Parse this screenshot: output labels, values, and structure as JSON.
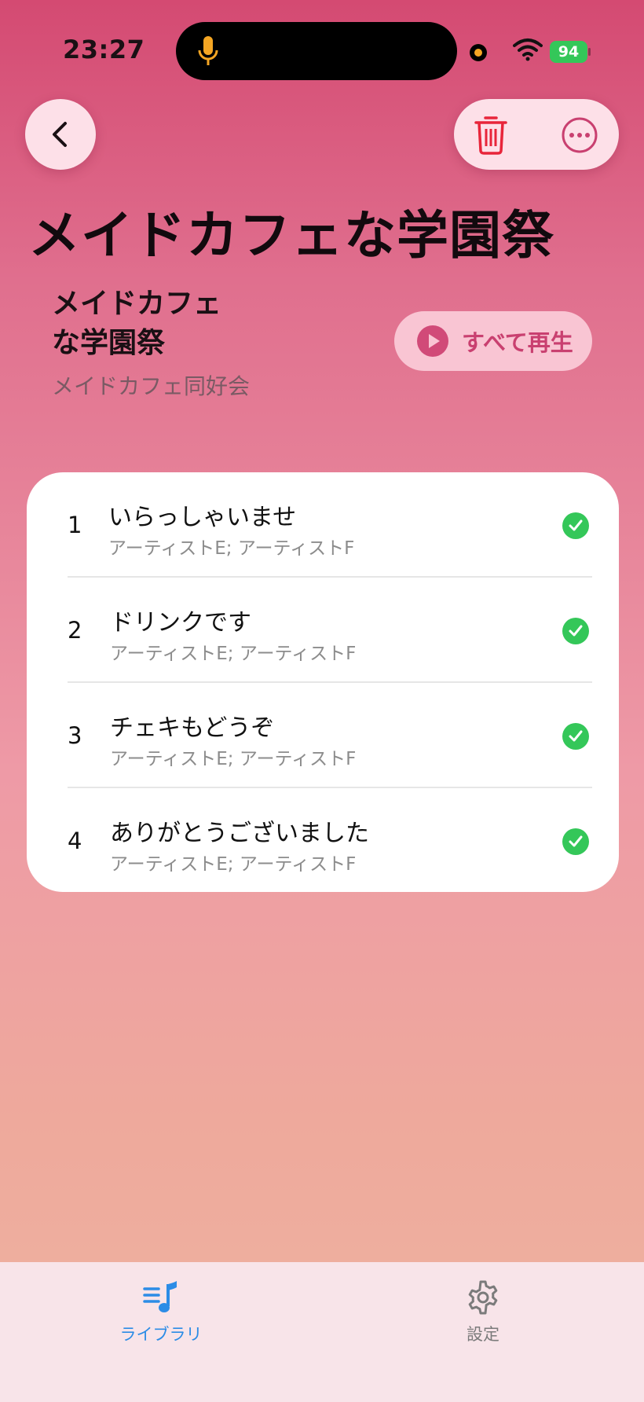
{
  "status_bar": {
    "time": "23:27",
    "battery": "94"
  },
  "header": {
    "title": "メイドカフェな学園祭"
  },
  "album": {
    "title_line1": "メイドカフェ",
    "title_line2": "な学園祭",
    "artist": "メイドカフェ同好会",
    "play_all_label": "すべて再生"
  },
  "tracks": [
    {
      "number": "1",
      "title": "いらっしゃいませ",
      "artists": "アーティストE; アーティストF"
    },
    {
      "number": "2",
      "title": "ドリンクです",
      "artists": "アーティストE; アーティストF"
    },
    {
      "number": "3",
      "title": "チェキもどうぞ",
      "artists": "アーティストE; アーティストF"
    },
    {
      "number": "4",
      "title": "ありがとうございました",
      "artists": "アーティストE; アーティストF"
    }
  ],
  "tab_bar": {
    "library_label": "ライブラリ",
    "settings_label": "設定"
  },
  "icons": {
    "back": "chevron-left-icon",
    "trash": "trash-icon",
    "more": "ellipsis-circle-icon",
    "play": "play-circle-icon",
    "check": "checkmark-circle-icon",
    "library": "music-list-icon",
    "settings": "gear-icon"
  },
  "colors": {
    "accent": "#c94070",
    "destructive": "#e8253a",
    "downloaded": "#34c759",
    "tab_active": "#2c8ce6",
    "tab_inactive": "#7b7b7b"
  }
}
